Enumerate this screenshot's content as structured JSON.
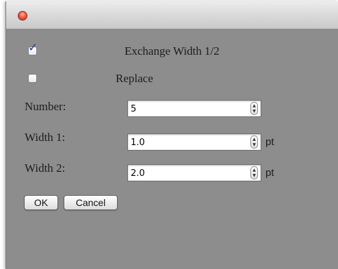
{
  "checkboxes": {
    "exchange": {
      "label": "Exchange Width 1/2",
      "checked": true
    },
    "replace": {
      "label": "Replace",
      "checked": false
    }
  },
  "fields": {
    "number": {
      "label": "Number:",
      "value": "5"
    },
    "width1": {
      "label": "Width 1:",
      "value": "1.0",
      "unit": "pt"
    },
    "width2": {
      "label": "Width 2:",
      "value": "2.0",
      "unit": "pt"
    }
  },
  "buttons": {
    "ok": "OK",
    "cancel": "Cancel"
  },
  "colors": {
    "window_background": "#8d8d8d",
    "close_button": "#e0443e"
  }
}
